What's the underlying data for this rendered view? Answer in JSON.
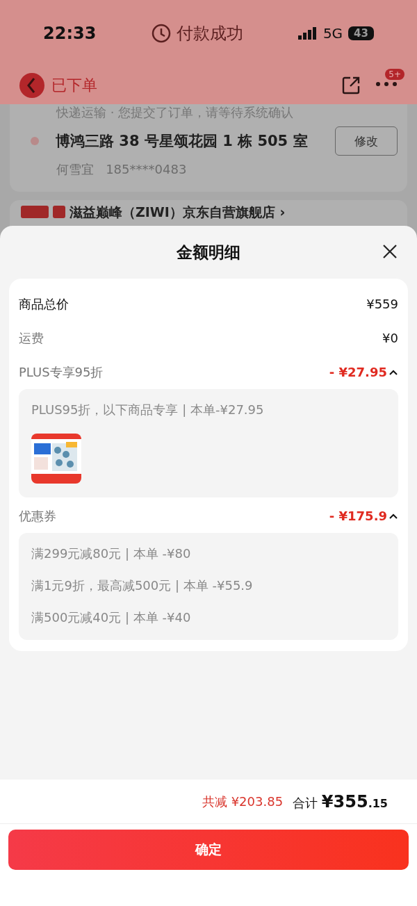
{
  "status_bar": {
    "time": "22:33",
    "title": "付款成功",
    "network": "5G",
    "battery": "43"
  },
  "header": {
    "status": "已下单",
    "badge": "5+"
  },
  "order_card": {
    "shipping_note": "快递运输 · 您提交了订单，请等待系统确认",
    "address": "博鸿三路 38 号星颂花园 1 栋 505 室",
    "contact_name": "何雪宜",
    "phone": "185****0483",
    "edit_button": "修改"
  },
  "store": {
    "name": "滋益巅峰（ZIWI）京东自营旗舰店 ›"
  },
  "sheet": {
    "title": "金额明细",
    "rows": [
      {
        "kind": "total",
        "label": "商品总价",
        "amount": "¥559"
      },
      {
        "kind": "fee",
        "label": "运费",
        "amount": "¥0"
      },
      {
        "kind": "discount",
        "label": "PLUS专享95折",
        "amount": "- ¥27.95",
        "expanded": true,
        "details": [
          "PLUS95折，以下商品专享 | 本单-¥27.95"
        ]
      },
      {
        "kind": "discount",
        "label": "优惠券",
        "amount": "- ¥175.9",
        "expanded": true,
        "details": [
          "满299元减80元 | 本单 -¥80",
          "满1元9折，最高减500元 | 本单 -¥55.9",
          "满500元减40元 | 本单 -¥40"
        ]
      }
    ]
  },
  "footer": {
    "saved_label": "共减",
    "saved": "¥203.85",
    "total_label": "合计",
    "total_currency": "¥",
    "total_int": "355",
    "total_decimal": ".15"
  },
  "confirm_button": "确定"
}
